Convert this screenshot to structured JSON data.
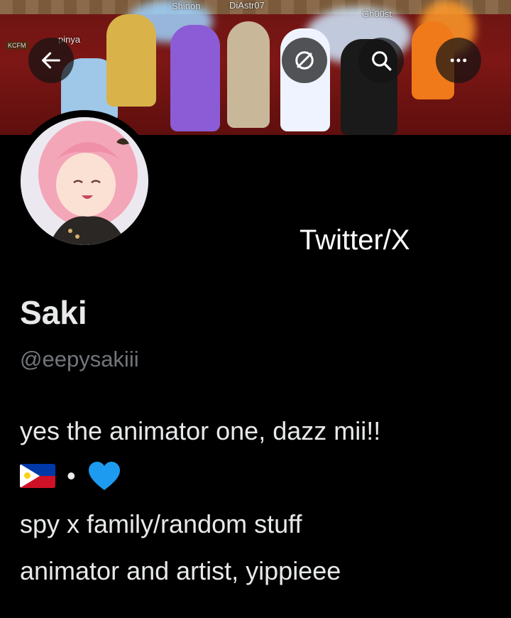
{
  "banner": {
    "usernames": [
      "Shinon",
      "DiAstr07",
      "Gh00st",
      "pinya",
      "KCFM"
    ]
  },
  "header": {
    "back_icon": "arrow-left-icon",
    "block_icon": "no-symbol-icon",
    "search_icon": "search-icon",
    "more_icon": "more-horizontal-icon"
  },
  "profile": {
    "caption": "Twitter/X",
    "display_name": "Saki",
    "handle": "@eepysakiii",
    "bio_line1": "yes the animator one, dazz mii!!",
    "bio_separator": "•",
    "bio_line3": "spy x family/random stuff",
    "bio_line4": "animator and artist,  yippieee"
  },
  "colors": {
    "background": "#000000",
    "text_primary": "#e7e9ea",
    "text_secondary": "#71767b",
    "heart": "#1d9bf0"
  }
}
